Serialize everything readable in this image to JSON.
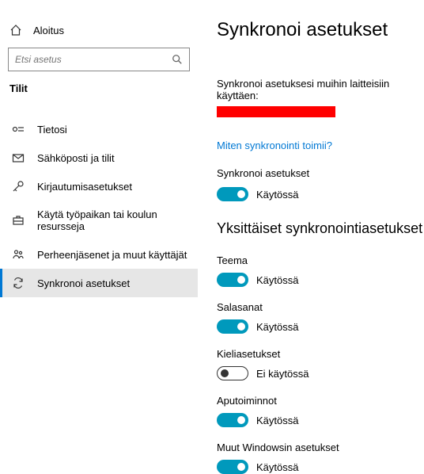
{
  "sidebar": {
    "home": "Aloitus",
    "search_placeholder": "Etsi asetus",
    "section": "Tilit",
    "items": [
      {
        "label": "Tietosi"
      },
      {
        "label": "Sähköposti ja tilit"
      },
      {
        "label": "Kirjautumisasetukset"
      },
      {
        "label": "Käytä työpaikan tai koulun resursseja"
      },
      {
        "label": "Perheenjäsenet ja muut käyttäjät"
      },
      {
        "label": "Synkronoi asetukset"
      }
    ]
  },
  "main": {
    "title": "Synkronoi asetukset",
    "intro": "Synkronoi asetuksesi muihin laitteisiin käyttäen:",
    "link": "Miten synkronointi toimii?",
    "sync_label": "Synkronoi asetukset",
    "on_text": "Käytössä",
    "off_text": "Ei käytössä",
    "section": "Yksittäiset synkronointiasetukset",
    "groups": [
      {
        "label": "Teema",
        "on": true
      },
      {
        "label": "Salasanat",
        "on": true
      },
      {
        "label": "Kieliasetukset",
        "on": false
      },
      {
        "label": "Aputoiminnot",
        "on": true
      },
      {
        "label": "Muut Windowsin asetukset",
        "on": true
      }
    ]
  }
}
